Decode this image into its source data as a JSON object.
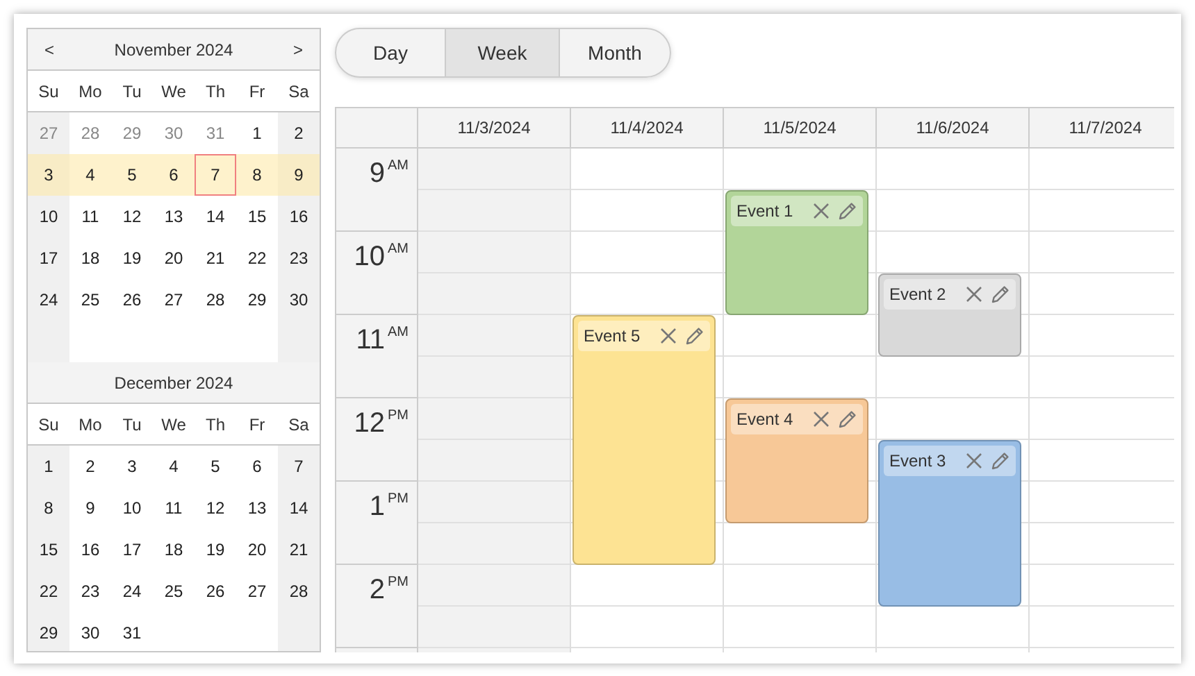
{
  "navigator": {
    "months": [
      {
        "title": "November 2024",
        "prev": "<",
        "next": ">",
        "day_names": [
          "Su",
          "Mo",
          "Tu",
          "We",
          "Th",
          "Fr",
          "Sa"
        ],
        "weeks": [
          {
            "selected": false,
            "days": [
              {
                "label": "27",
                "other_month": true,
                "today": false
              },
              {
                "label": "28",
                "other_month": true,
                "today": false
              },
              {
                "label": "29",
                "other_month": true,
                "today": false
              },
              {
                "label": "30",
                "other_month": true,
                "today": false
              },
              {
                "label": "31",
                "other_month": true,
                "today": false
              },
              {
                "label": "1",
                "other_month": false,
                "today": false
              },
              {
                "label": "2",
                "other_month": false,
                "today": false
              }
            ]
          },
          {
            "selected": true,
            "days": [
              {
                "label": "3",
                "other_month": false,
                "today": false
              },
              {
                "label": "4",
                "other_month": false,
                "today": false
              },
              {
                "label": "5",
                "other_month": false,
                "today": false
              },
              {
                "label": "6",
                "other_month": false,
                "today": false
              },
              {
                "label": "7",
                "other_month": false,
                "today": true
              },
              {
                "label": "8",
                "other_month": false,
                "today": false
              },
              {
                "label": "9",
                "other_month": false,
                "today": false
              }
            ]
          },
          {
            "selected": false,
            "days": [
              {
                "label": "10",
                "other_month": false,
                "today": false
              },
              {
                "label": "11",
                "other_month": false,
                "today": false
              },
              {
                "label": "12",
                "other_month": false,
                "today": false
              },
              {
                "label": "13",
                "other_month": false,
                "today": false
              },
              {
                "label": "14",
                "other_month": false,
                "today": false
              },
              {
                "label": "15",
                "other_month": false,
                "today": false
              },
              {
                "label": "16",
                "other_month": false,
                "today": false
              }
            ]
          },
          {
            "selected": false,
            "days": [
              {
                "label": "17",
                "other_month": false,
                "today": false
              },
              {
                "label": "18",
                "other_month": false,
                "today": false
              },
              {
                "label": "19",
                "other_month": false,
                "today": false
              },
              {
                "label": "20",
                "other_month": false,
                "today": false
              },
              {
                "label": "21",
                "other_month": false,
                "today": false
              },
              {
                "label": "22",
                "other_month": false,
                "today": false
              },
              {
                "label": "23",
                "other_month": false,
                "today": false
              }
            ]
          },
          {
            "selected": false,
            "days": [
              {
                "label": "24",
                "other_month": false,
                "today": false
              },
              {
                "label": "25",
                "other_month": false,
                "today": false
              },
              {
                "label": "26",
                "other_month": false,
                "today": false
              },
              {
                "label": "27",
                "other_month": false,
                "today": false
              },
              {
                "label": "28",
                "other_month": false,
                "today": false
              },
              {
                "label": "29",
                "other_month": false,
                "today": false
              },
              {
                "label": "30",
                "other_month": false,
                "today": false
              }
            ]
          }
        ]
      },
      {
        "title": "December 2024",
        "day_names": [
          "Su",
          "Mo",
          "Tu",
          "We",
          "Th",
          "Fr",
          "Sa"
        ],
        "weeks": [
          {
            "selected": false,
            "days": [
              {
                "label": "1",
                "other_month": false,
                "today": false
              },
              {
                "label": "2",
                "other_month": false,
                "today": false
              },
              {
                "label": "3",
                "other_month": false,
                "today": false
              },
              {
                "label": "4",
                "other_month": false,
                "today": false
              },
              {
                "label": "5",
                "other_month": false,
                "today": false
              },
              {
                "label": "6",
                "other_month": false,
                "today": false
              },
              {
                "label": "7",
                "other_month": false,
                "today": false
              }
            ]
          },
          {
            "selected": false,
            "days": [
              {
                "label": "8",
                "other_month": false,
                "today": false
              },
              {
                "label": "9",
                "other_month": false,
                "today": false
              },
              {
                "label": "10",
                "other_month": false,
                "today": false
              },
              {
                "label": "11",
                "other_month": false,
                "today": false
              },
              {
                "label": "12",
                "other_month": false,
                "today": false
              },
              {
                "label": "13",
                "other_month": false,
                "today": false
              },
              {
                "label": "14",
                "other_month": false,
                "today": false
              }
            ]
          },
          {
            "selected": false,
            "days": [
              {
                "label": "15",
                "other_month": false,
                "today": false
              },
              {
                "label": "16",
                "other_month": false,
                "today": false
              },
              {
                "label": "17",
                "other_month": false,
                "today": false
              },
              {
                "label": "18",
                "other_month": false,
                "today": false
              },
              {
                "label": "19",
                "other_month": false,
                "today": false
              },
              {
                "label": "20",
                "other_month": false,
                "today": false
              },
              {
                "label": "21",
                "other_month": false,
                "today": false
              }
            ]
          },
          {
            "selected": false,
            "days": [
              {
                "label": "22",
                "other_month": false,
                "today": false
              },
              {
                "label": "23",
                "other_month": false,
                "today": false
              },
              {
                "label": "24",
                "other_month": false,
                "today": false
              },
              {
                "label": "25",
                "other_month": false,
                "today": false
              },
              {
                "label": "26",
                "other_month": false,
                "today": false
              },
              {
                "label": "27",
                "other_month": false,
                "today": false
              },
              {
                "label": "28",
                "other_month": false,
                "today": false
              }
            ]
          },
          {
            "selected": false,
            "days": [
              {
                "label": "29",
                "other_month": false,
                "today": false
              },
              {
                "label": "30",
                "other_month": false,
                "today": false
              },
              {
                "label": "31",
                "other_month": false,
                "today": false
              }
            ]
          }
        ]
      }
    ]
  },
  "views": [
    {
      "label": "Day",
      "selected": false
    },
    {
      "label": "Week",
      "selected": true
    },
    {
      "label": "Month",
      "selected": false
    }
  ],
  "scheduler": {
    "hours": [
      {
        "hour": "9",
        "period": "AM"
      },
      {
        "hour": "10",
        "period": "AM"
      },
      {
        "hour": "11",
        "period": "AM"
      },
      {
        "hour": "12",
        "period": "PM"
      },
      {
        "hour": "1",
        "period": "PM"
      },
      {
        "hour": "2",
        "period": "PM"
      }
    ],
    "days": [
      {
        "label": "11/3/2024",
        "weekend": true,
        "slots": [
          {
            "kind": "free"
          },
          {
            "kind": "free"
          },
          {
            "kind": "free"
          },
          {
            "kind": "free"
          },
          {
            "kind": "free"
          },
          {
            "kind": "free"
          },
          {
            "kind": "free"
          },
          {
            "kind": "free"
          },
          {
            "kind": "free"
          },
          {
            "kind": "free"
          },
          {
            "kind": "free"
          },
          {
            "kind": "free"
          }
        ]
      },
      {
        "label": "11/4/2024",
        "weekend": false,
        "slots": [
          {
            "kind": "free"
          },
          {
            "kind": "free"
          },
          {
            "kind": "free"
          },
          {
            "kind": "free"
          },
          {
            "kind": "event",
            "title": "Event 5",
            "color": "#fde087"
          },
          {
            "kind": "continued"
          },
          {
            "kind": "continued"
          },
          {
            "kind": "continued"
          },
          {
            "kind": "continued"
          },
          {
            "kind": "continued"
          },
          {
            "kind": "free"
          },
          {
            "kind": "free"
          }
        ]
      },
      {
        "label": "11/5/2024",
        "weekend": false,
        "slots": [
          {
            "kind": "free"
          },
          {
            "kind": "event",
            "title": "Event 1",
            "color": "#a9d08e"
          },
          {
            "kind": "continued"
          },
          {
            "kind": "continued"
          },
          {
            "kind": "free"
          },
          {
            "kind": "free"
          },
          {
            "kind": "event",
            "title": "Event 4",
            "color": "#f6c28b"
          },
          {
            "kind": "continued"
          },
          {
            "kind": "continued"
          },
          {
            "kind": "free"
          },
          {
            "kind": "free"
          },
          {
            "kind": "free"
          }
        ]
      },
      {
        "label": "11/6/2024",
        "weekend": false,
        "slots": [
          {
            "kind": "free"
          },
          {
            "kind": "free"
          },
          {
            "kind": "free"
          },
          {
            "kind": "event",
            "title": "Event 2",
            "color": "#d5d5d5"
          },
          {
            "kind": "continued"
          },
          {
            "kind": "free"
          },
          {
            "kind": "free"
          },
          {
            "kind": "event",
            "title": "Event 3",
            "color": "#8db6e2"
          },
          {
            "kind": "continued"
          },
          {
            "kind": "continued"
          },
          {
            "kind": "continued"
          },
          {
            "kind": "free"
          }
        ]
      },
      {
        "label": "11/7/2024",
        "weekend": false,
        "slots": [
          {
            "kind": "free"
          },
          {
            "kind": "free"
          },
          {
            "kind": "free"
          },
          {
            "kind": "free"
          },
          {
            "kind": "free"
          },
          {
            "kind": "free"
          },
          {
            "kind": "free"
          },
          {
            "kind": "free"
          },
          {
            "kind": "free"
          },
          {
            "kind": "free"
          },
          {
            "kind": "free"
          },
          {
            "kind": "free"
          }
        ]
      }
    ]
  }
}
